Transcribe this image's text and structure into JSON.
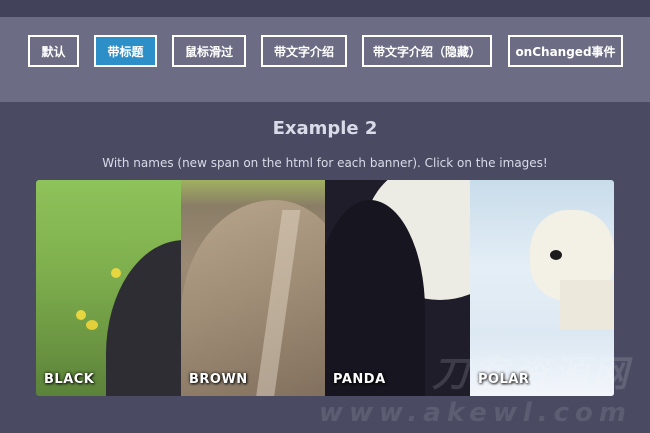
{
  "toolbar": {
    "buttons": [
      {
        "label": "默认",
        "active": false
      },
      {
        "label": "带标题",
        "active": true
      },
      {
        "label": "鼠标滑过",
        "active": false
      },
      {
        "label": "带文字介绍",
        "active": false
      },
      {
        "label": "带文字介绍（隐藏）",
        "active": false
      },
      {
        "label": "onChanged事件",
        "active": false
      }
    ]
  },
  "main": {
    "title": "Example 2",
    "subtitle": "With names (new span on the html for each banner). Click on the images!"
  },
  "gallery": {
    "panels": [
      {
        "label": "BLACK"
      },
      {
        "label": "BROWN"
      },
      {
        "label": "PANDA"
      },
      {
        "label": "POLAR"
      }
    ]
  },
  "watermark": {
    "text": "刀客资源网",
    "url": "www.akewl.com"
  },
  "colors": {
    "background": "#4a4a62",
    "toolbar": "#6c6c84",
    "active_button": "#2c8fc7"
  }
}
